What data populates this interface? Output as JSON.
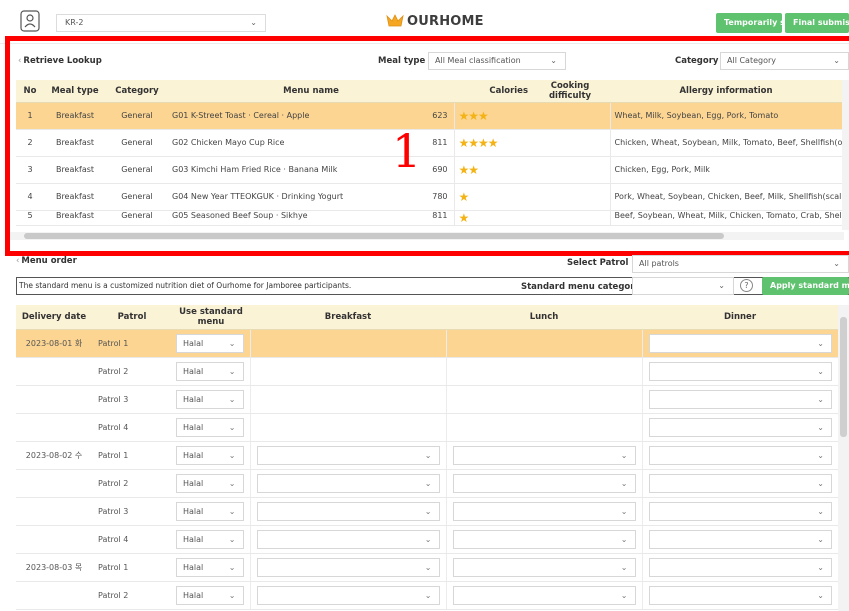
{
  "header": {
    "unit_select_value": "KR-2",
    "logo_text": "OURHOME",
    "temp_save_label": "Temporarily s",
    "final_submit_label": "Final submis"
  },
  "lookup": {
    "title": "Retrieve Lookup",
    "meal_type_label": "Meal type",
    "meal_type_value": "All Meal classification",
    "category_label": "Category",
    "category_value": "All Category",
    "columns": [
      "No",
      "Meal type",
      "Category",
      "Menu name",
      "Calories",
      "Cooking difficulty",
      "Allergy information"
    ],
    "rows": [
      {
        "no": "1",
        "meal": "Breakfast",
        "cat": "General",
        "menu": "G01 K-Street Toast · Cereal · Apple",
        "cal": "623",
        "stars": "★★★",
        "allergy": "Wheat, Milk, Soybean, Egg, Pork, Tomato"
      },
      {
        "no": "2",
        "meal": "Breakfast",
        "cat": "General",
        "menu": "G02 Chicken Mayo Cup Rice",
        "cal": "811",
        "stars": "★★★★",
        "allergy": "Chicken, Wheat, Soybean, Milk, Tomato, Beef, Shellfish(oyster), Egg, Mac"
      },
      {
        "no": "3",
        "meal": "Breakfast",
        "cat": "General",
        "menu": "G03 Kimchi Ham Fried Rice · Banana Milk",
        "cal": "690",
        "stars": "★★",
        "allergy": "Chicken, Egg, Pork, Milk"
      },
      {
        "no": "4",
        "meal": "Breakfast",
        "cat": "General",
        "menu": "G04 New Year TTEOKGUK · Drinking Yogurt",
        "cal": "780",
        "stars": "★",
        "allergy": "Pork, Wheat, Soybean, Chicken, Beef, Milk, Shellfish(scallops), Egg, Milk"
      },
      {
        "no": "5",
        "meal": "Breakfast",
        "cat": "General",
        "menu": "G05 Seasoned Beef Soup · Sikhye",
        "cal": "811",
        "stars": "★",
        "allergy": "Beef, Soybean, Wheat, Milk, Chicken, Tomato, Crab, Shellfish(mussels, oyste"
      }
    ],
    "annotation": "1"
  },
  "menu_order": {
    "title": "Menu order",
    "select_patrol_label": "Select Patrol",
    "select_patrol_value": "All patrols",
    "info_text": "The standard menu is a customized nutrition diet of Ourhome for Jamboree participants.",
    "std_category_label": "Standard menu category",
    "std_category_value": "",
    "apply_label": "Apply standard me",
    "help_glyph": "?",
    "columns": [
      "Delivery date",
      "Patrol",
      "Use standard menu",
      "Breakfast",
      "Lunch",
      "Dinner"
    ],
    "rows": [
      {
        "date": "2023-08-01 화",
        "patrol": "Patrol 1",
        "std": "Halal",
        "sel": true,
        "b": false,
        "l": false,
        "d": true
      },
      {
        "date": "",
        "patrol": "Patrol 2",
        "std": "Halal",
        "b": false,
        "l": false,
        "d": true
      },
      {
        "date": "",
        "patrol": "Patrol 3",
        "std": "Halal",
        "b": false,
        "l": false,
        "d": true
      },
      {
        "date": "",
        "patrol": "Patrol 4",
        "std": "Halal",
        "b": false,
        "l": false,
        "d": true
      },
      {
        "date": "2023-08-02 수",
        "patrol": "Patrol 1",
        "std": "Halal",
        "b": true,
        "l": true,
        "d": true
      },
      {
        "date": "",
        "patrol": "Patrol 2",
        "std": "Halal",
        "b": true,
        "l": true,
        "d": true
      },
      {
        "date": "",
        "patrol": "Patrol 3",
        "std": "Halal",
        "b": true,
        "l": true,
        "d": true
      },
      {
        "date": "",
        "patrol": "Patrol 4",
        "std": "Halal",
        "b": true,
        "l": true,
        "d": true
      },
      {
        "date": "2023-08-03 목",
        "patrol": "Patrol 1",
        "std": "Halal",
        "b": true,
        "l": true,
        "d": true
      },
      {
        "date": "",
        "patrol": "Patrol 2",
        "std": "Halal",
        "b": true,
        "l": true,
        "d": true
      }
    ]
  },
  "colors": {
    "accent_green": "#5ec26f",
    "header_row": "#fbf3d6",
    "selected_row": "#fcd592",
    "annotation_red": "#ff0000",
    "star": "#f4b315"
  },
  "icons": {
    "user": "person-icon",
    "logo": "ourhome-logo-icon",
    "chevron": "chevron-down-icon",
    "help": "help-icon"
  }
}
